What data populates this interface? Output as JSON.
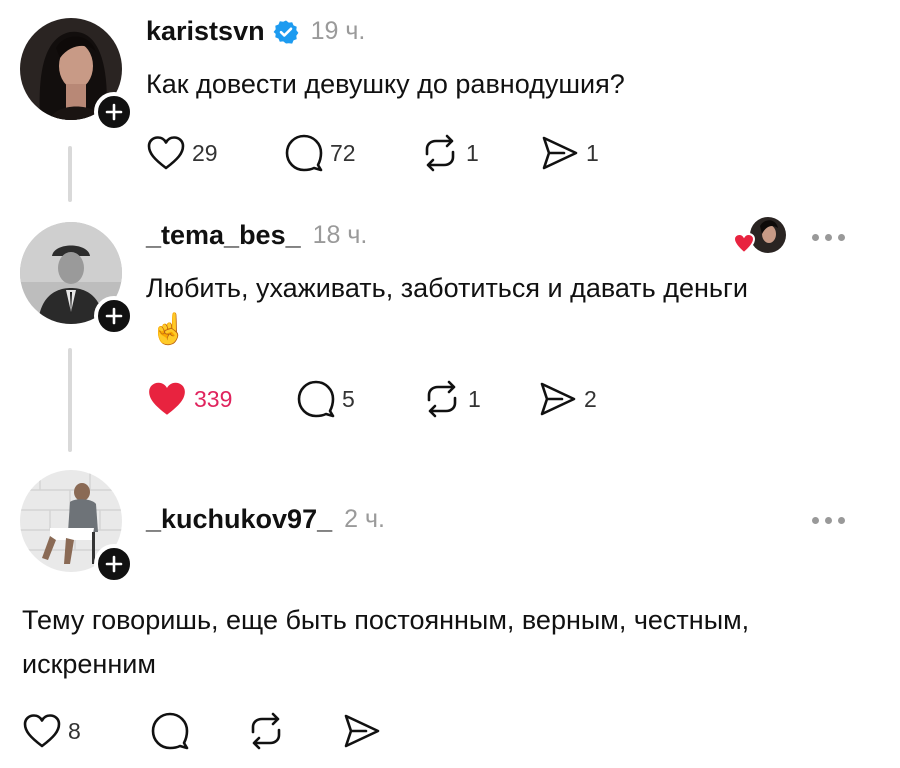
{
  "posts": [
    {
      "username": "karistsvn",
      "verified": true,
      "time": "19 ч.",
      "text": "Как довести девушку до равнодушия?",
      "likes": "29",
      "liked": false,
      "replies": "72",
      "reposts": "1",
      "shares": "1"
    },
    {
      "username": "_tema_bes_",
      "verified": false,
      "time": "18 ч.",
      "text": "Любить, ухаживать, заботиться и давать деньги",
      "emoji": "☝️",
      "likes": "339",
      "liked": true,
      "replies": "5",
      "reposts": "1",
      "shares": "2"
    },
    {
      "username": "_kuchukov97_",
      "verified": false,
      "time": "2 ч.",
      "text_line1": "Тему говоришь, еще быть постоянным, верным, честным,",
      "text_line2": "искренним",
      "likes": "8",
      "liked": false
    }
  ],
  "colors": {
    "like_red": "#e8233f",
    "muted": "#9a9a9a",
    "verified_blue": "#1d9bf0"
  }
}
